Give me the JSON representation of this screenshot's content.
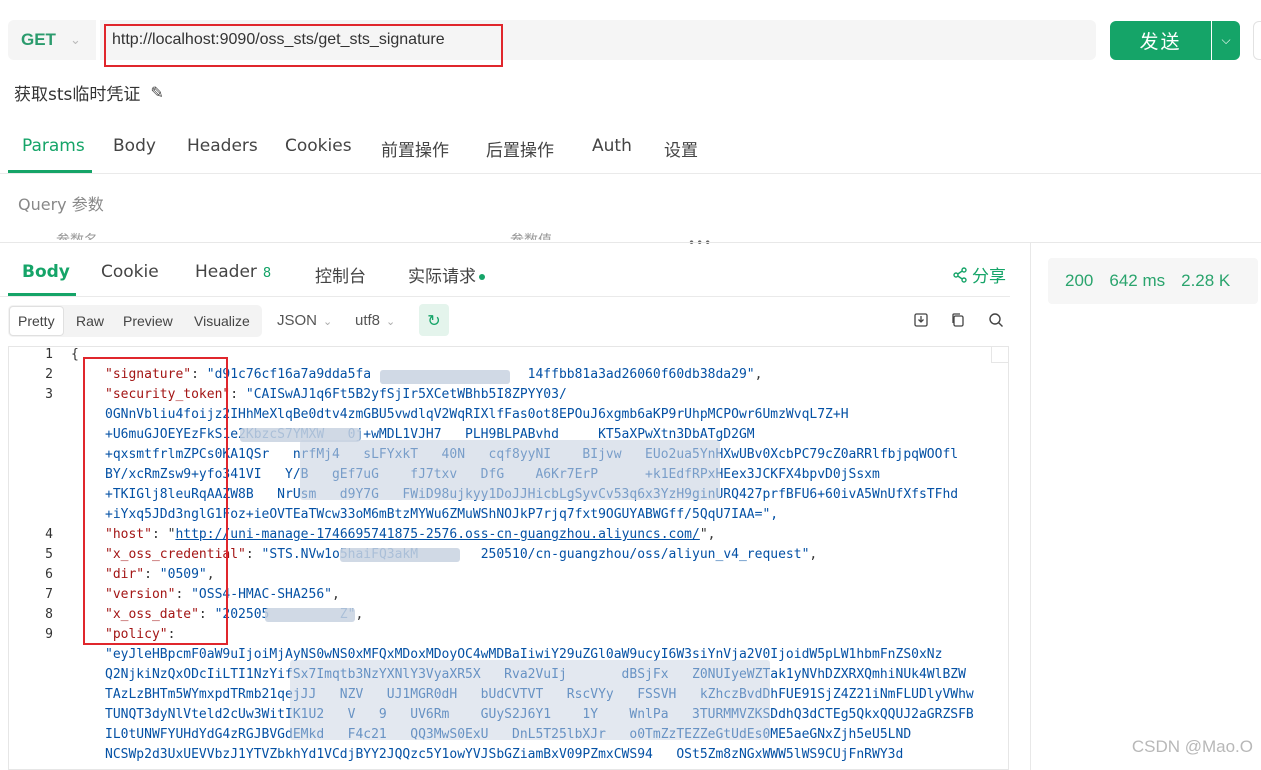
{
  "request": {
    "method": "GET",
    "url": "http://localhost:9090/oss_sts/get_sts_signature",
    "send_label": "发送"
  },
  "api": {
    "name": "获取sts临时凭证"
  },
  "request_tabs": [
    "Params",
    "Body",
    "Headers",
    "Cookies",
    "前置操作",
    "后置操作",
    "Auth",
    "设置"
  ],
  "params": {
    "section_label": "Query 参数",
    "col_name": "参数名",
    "col_value": "参数值"
  },
  "response_tabs": {
    "body": "Body",
    "cookie": "Cookie",
    "header": "Header",
    "header_count": "8",
    "console": "控制台",
    "actual_request": "实际请求"
  },
  "share_label": "分享",
  "status": {
    "code": "200",
    "time": "642 ms",
    "size": "2.28 K"
  },
  "view_modes": [
    "Pretty",
    "Raw",
    "Preview",
    "Visualize"
  ],
  "format": "JSON",
  "encoding": "utf8",
  "code": {
    "line_numbers": [
      "1",
      "2",
      "3",
      "4",
      "5",
      "6",
      "7",
      "8",
      "9"
    ],
    "open_brace": "{",
    "signature_key": "\"signature\"",
    "signature_val": "\"d91c76cf16a7a9dda5fa                    14ffbb81a3ad26060f60db38da29\"",
    "token_key": "\"security_token\"",
    "token_val": [
      "\"CAISwAJ1q6Ft5B2yfSjIr5XCetWBhb5I8ZPYY03/",
      "0GNnVbliu4foijz2IHhMeXlqBe0dtv4zmGBU5vwdlqV2WqRIXlfFas0ot8EPOuJ6xgmb6aKP9rUhpMCPOwr6UmzWvqL7Z+H",
      "+U6muGJOEYEzFkS1e2KbzcS7YMXW   0j+wMDL1VJH7   PLH9BLPABvhd     KT5aXPwXtn3DbATgD2GM",
      "+qxsmtfrlmZPCs0KA1QSr   nrfMj4   sLFYxkT   40N   cqf8yyNI    BIjvw   EUo2ua5YnHXwUBv0XcbPC79cZ0aRRlfbjpqWOOfl",
      "BY/xcRmZsw9+yfo341VI   Y/B   gEf7uG    fJ7txv   DfG    A6Kr7ErP      +k1EdfRPxHEex3JCKFX4bpvD0jSsxm",
      "+TKIGlj8leuRqAAZW8B   NrUsm   d9Y7G   FWiD98ujkyy1DoJJHicbLgSyvCv53q6x3YzH9ginURQ427prfBFU6+60ivA5WnUfXfsTFhd",
      "+iYxq5JDd3nglG1Foz+ieOVTEaTWcw33oM6mBtzMYWu6ZMuWShNOJkP7rjq7fxt9OGUYABWGff/5QqU7IAA=\","
    ],
    "host_key": "\"host\"",
    "host_val": "http://uni-manage-1746695741875-2576.oss-cn-guangzhou.aliyuncs.com/",
    "cred_key": "\"x_oss_credential\"",
    "cred_val": "\"STS.NVw1o5haiFQ3akM        250510/cn-guangzhou/oss/aliyun_v4_request\"",
    "dir_key": "\"dir\"",
    "dir_val": "\"0509\"",
    "version_key": "\"version\"",
    "version_val": "\"OSS4-HMAC-SHA256\"",
    "date_key": "\"x_oss_date\"",
    "date_val": "\"202505         Z\"",
    "policy_key": "\"policy\"",
    "policy_val": [
      "\"eyJleHBpcmF0aW9uIjoiMjAyNS0wNS0xMFQxMDoxMDoyOC4wMDBaIiwiY29uZGl0aW9ucyI6W3siYnVja2V0IjoidW5pLW1hbmFnZS0xNz",
      "Q2NjkiNzQxODcIiLTI1NzYifSx7Imqtb3NzYXNlY3VyaXR5X   Rva2VuIj       dBSjFx   Z0NUIyeWZTak1yNVhDZXRXQmhiNUk4WlBZW",
      "TAzLzBHTm5WYmxpdTRmb21qejJJ   NZV   UJ1MGR0dH   bUdCVTVT   RscVYy   FSSVH   kZhczBvdDhFUE91SjZ4Z21iNmFLUDlyVWhw",
      "TUNQT3dyNlVteld2cUw3WitIK1U2   V   9   UV6Rm    GUyS2J6Y1    1Y    WnlPa   3TURMMVZKSDdhQ3dCTEg5QkxQQUJ2aGRZSFB",
      "IL0tUNWFYUHdYdG4zRGJBVGdEMkd   F4c21   QQ3MwS0ExU   DnL5T25lbXJr   o0TmZzTEZZeGtUdEs0ME5aeGNxZjh5eU5LND",
      "NCSWp2d3UxUEVVbzJ1YTVZbkhYd1VCdjBYY2JQQzc5Y1owYVJSbGZiamBxV09PZmxCWS94   OSt5Zm8zNGxWWW5lWS9CUjFnRWY3d"
    ]
  },
  "watermark": "CSDN @Mao.O"
}
